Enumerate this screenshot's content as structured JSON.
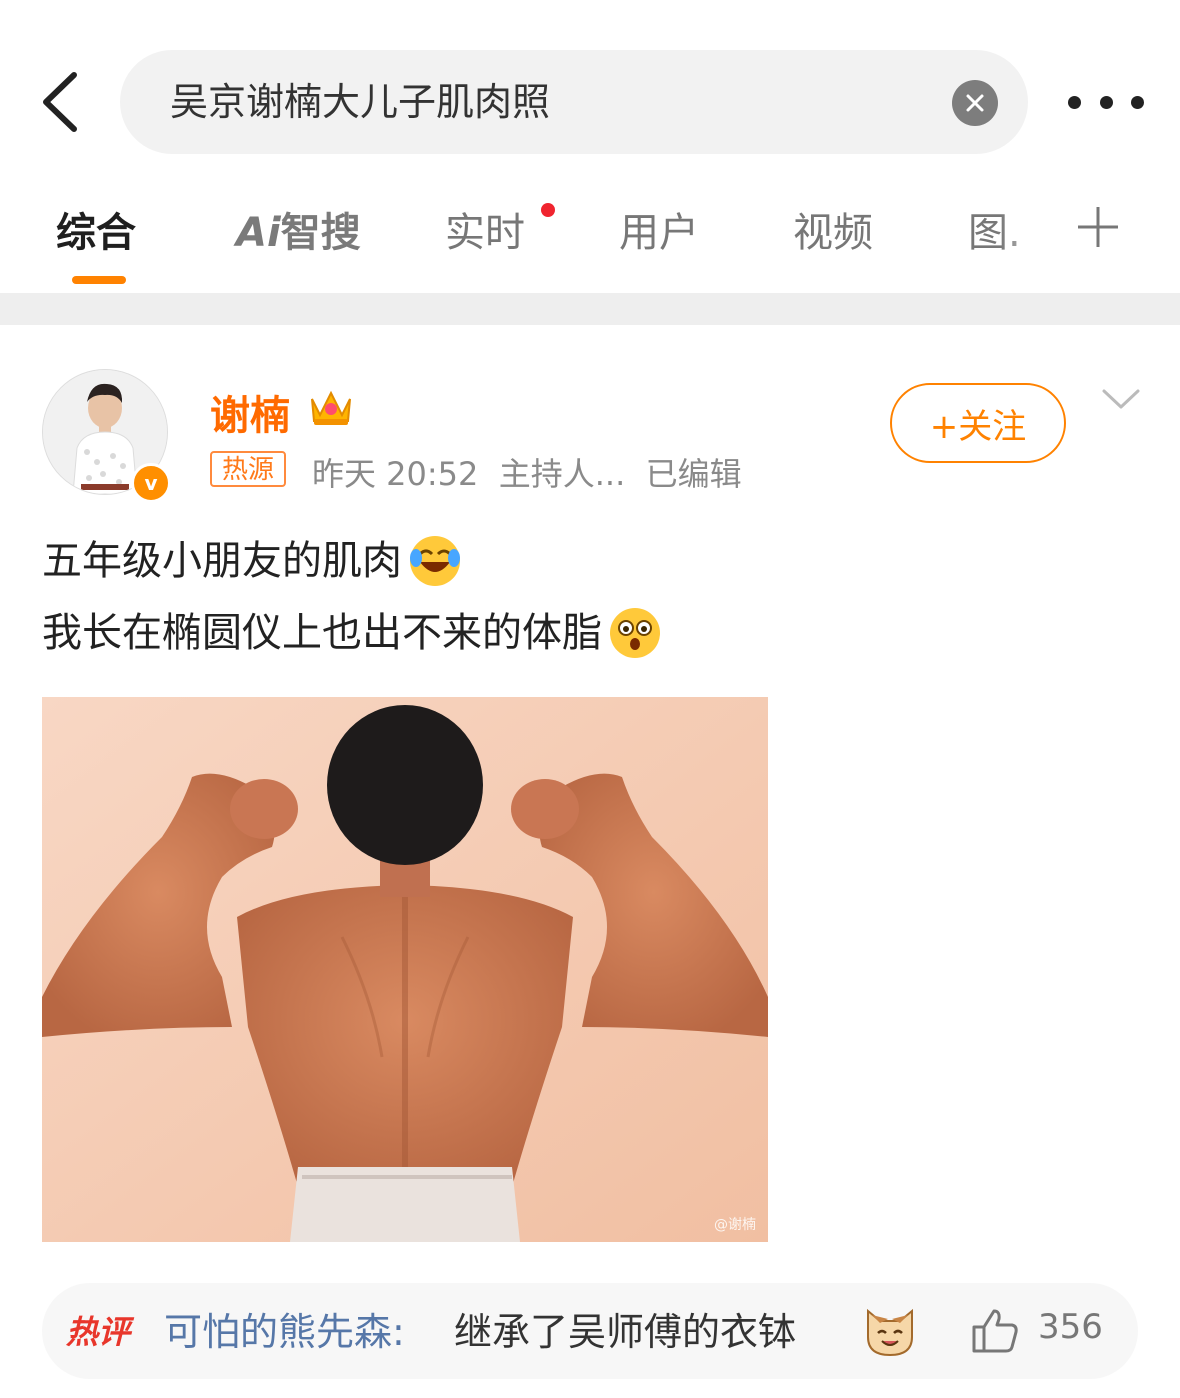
{
  "search": {
    "query": "吴京谢楠大儿子肌肉照"
  },
  "tabs": [
    {
      "label": "综合"
    },
    {
      "label": "智搜",
      "prefix": "Ai"
    },
    {
      "label": "实时"
    },
    {
      "label": "用户"
    },
    {
      "label": "视频"
    },
    {
      "label": "图."
    }
  ],
  "post": {
    "author": "谢楠",
    "badge": "热源",
    "time": "昨天 20:52",
    "role": "主持人...",
    "edited": "已编辑",
    "follow_label": "+关注",
    "text_line1": "五年级小朋友的肌肉",
    "text_line2": "我长在椭圆仪上也出不来的体脂",
    "watermark": "@谢楠"
  },
  "hot_comment": {
    "label": "热评",
    "user": "可怕的熊先森:",
    "text": "继承了吴师傅的衣钵",
    "likes": "356"
  },
  "colors": {
    "accent": "#ff8200",
    "username": "#ff6a00",
    "hot_red": "#e8362b",
    "link_blue": "#5677a8"
  }
}
